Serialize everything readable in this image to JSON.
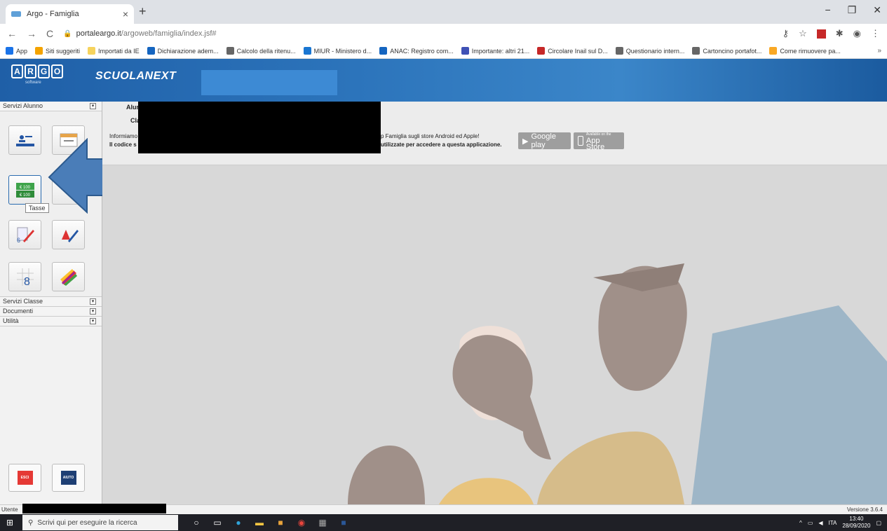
{
  "browser": {
    "tab_title": "Argo - Famiglia",
    "tab_close": "×",
    "new_tab": "+",
    "url_host": "portaleargo.it",
    "url_path": "/argoweb/famiglia/index.jsf#",
    "window_minimize": "−",
    "window_maximize": "❐",
    "window_close": "✕",
    "nav_back": "←",
    "nav_forward": "→",
    "nav_reload": "C"
  },
  "bookmarks": {
    "items": [
      {
        "label": "App",
        "color": "#1a73e8"
      },
      {
        "label": "Siti suggeriti",
        "color": "#f4a300"
      },
      {
        "label": "Importati da IE",
        "color": "#f6d35d"
      },
      {
        "label": "Dichiarazione adem...",
        "color": "#1565c0"
      },
      {
        "label": "Calcolo della ritenu...",
        "color": "#666666"
      },
      {
        "label": "MIUR - Ministero d...",
        "color": "#1976d2"
      },
      {
        "label": "ANAC: Registro com...",
        "color": "#1565c0"
      },
      {
        "label": "Importante: altri 21...",
        "color": "#3f51b5"
      },
      {
        "label": "Circolare Inail sul D...",
        "color": "#c62828"
      },
      {
        "label": "Questionario intern...",
        "color": "#666666"
      },
      {
        "label": "Cartoncino portafot...",
        "color": "#666666"
      },
      {
        "label": "Come rimuovere pa...",
        "color": "#f9a825"
      }
    ],
    "more": "»"
  },
  "header": {
    "logo_letters": [
      "A",
      "R",
      "G",
      "O"
    ],
    "logo_sub": "software",
    "product": "SCUOLANEXT"
  },
  "sidebar": {
    "sections": {
      "servizi_alunno": "Servizi Alunno",
      "servizi_classe": "Servizi Classe",
      "documenti": "Documenti",
      "utilita": "Utilità"
    },
    "tooltip": "Tasse",
    "esci": "ESCI",
    "aiuto": "AIUTO"
  },
  "info": {
    "alunno_label": "Alunno",
    "classe_label": "Classe",
    "info_prefix": "Informiamo",
    "info_suffix": "p Famiglia sugli store Android ed Apple!",
    "codice_prefix": "Il codice s",
    "codice_suffix": "utilizzate per accedere a questa applicazione.",
    "google_play": "Google play",
    "app_store_small": "Available on the",
    "app_store": "App Store"
  },
  "statusbar": {
    "utente": "Utente",
    "versione": "Versione 3.6.4"
  },
  "taskbar": {
    "search_placeholder": "Scrivi qui per eseguire la ricerca",
    "lang": "ITA",
    "time": "13:40",
    "date": "28/09/2020"
  }
}
